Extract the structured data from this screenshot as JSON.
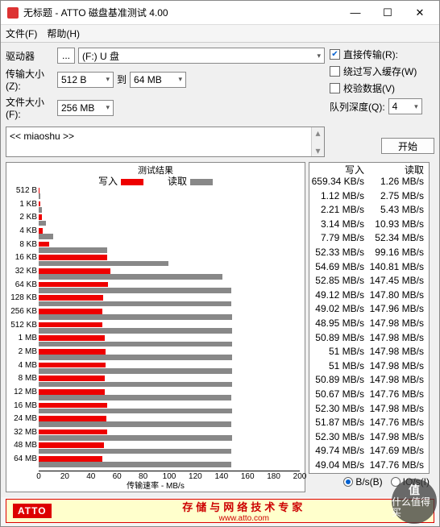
{
  "window": {
    "title": "无标题 - ATTO 磁盘基准测试 4.00",
    "min": "—",
    "max": "☐",
    "close": "✕"
  },
  "menu": {
    "file": "文件(F)",
    "help": "帮助(H)"
  },
  "labels": {
    "drive": "驱动器",
    "browse": "...",
    "drive_val": "(F:) U 盘",
    "xfer": "传输大小(Z):",
    "xfer_from": "512 B",
    "to": "到",
    "xfer_to": "64 MB",
    "file": "文件大小(F):",
    "file_val": "256 MB",
    "direct": "直接传输(R):",
    "bypass": "绕过写入缓存(W)",
    "verify": "校验数据(V)",
    "qd": "队列深度(Q):",
    "qd_val": "4",
    "desc": "<< miaoshu >>",
    "start": "开始",
    "result_title": "测试结果",
    "write": "写入",
    "read": "读取",
    "xlabel": "传输速率 - MB/s",
    "bs": "B/s(B)",
    "ios": "IO/s(I)"
  },
  "footer": {
    "logo": "ATTO",
    "l1": "存储与网络技术专家",
    "l2": "www.atto.com"
  },
  "watermark": {
    "v": "值",
    "t": "什么值得买"
  },
  "chart_data": {
    "type": "bar",
    "xlabel": "传输速率 - MB/s",
    "xlim": [
      0,
      200
    ],
    "xticks": [
      0,
      20,
      40,
      60,
      80,
      100,
      120,
      140,
      160,
      180,
      200
    ],
    "categories": [
      "512 B",
      "1 KB",
      "2 KB",
      "4 KB",
      "8 KB",
      "16 KB",
      "32 KB",
      "64 KB",
      "128 KB",
      "256 KB",
      "512 KB",
      "1 MB",
      "2 MB",
      "4 MB",
      "8 MB",
      "12 MB",
      "16 MB",
      "24 MB",
      "32 MB",
      "48 MB",
      "64 MB"
    ],
    "series": [
      {
        "name": "写入",
        "color": "#e00",
        "unit": "MB/s",
        "labels": [
          "659.34 KB/s",
          "1.12 MB/s",
          "2.21 MB/s",
          "3.14 MB/s",
          "7.79 MB/s",
          "52.33 MB/s",
          "54.69 MB/s",
          "52.85 MB/s",
          "49.12 MB/s",
          "49.02 MB/s",
          "48.95 MB/s",
          "50.89 MB/s",
          "51 MB/s",
          "51 MB/s",
          "50.89 MB/s",
          "50.67 MB/s",
          "52.30 MB/s",
          "51.87 MB/s",
          "52.30 MB/s",
          "49.74 MB/s",
          "49.04 MB/s"
        ],
        "values": [
          0.64,
          1.12,
          2.21,
          3.14,
          7.79,
          52.33,
          54.69,
          52.85,
          49.12,
          49.02,
          48.95,
          50.89,
          51,
          51,
          50.89,
          50.67,
          52.3,
          51.87,
          52.3,
          49.74,
          49.04
        ]
      },
      {
        "name": "读取",
        "color": "#888",
        "unit": "MB/s",
        "labels": [
          "1.26 MB/s",
          "2.75 MB/s",
          "5.43 MB/s",
          "10.93 MB/s",
          "52.34 MB/s",
          "99.16 MB/s",
          "140.81 MB/s",
          "147.45 MB/s",
          "147.80 MB/s",
          "147.96 MB/s",
          "147.98 MB/s",
          "147.98 MB/s",
          "147.98 MB/s",
          "147.98 MB/s",
          "147.98 MB/s",
          "147.76 MB/s",
          "147.98 MB/s",
          "147.76 MB/s",
          "147.98 MB/s",
          "147.69 MB/s",
          "147.76 MB/s"
        ],
        "values": [
          1.26,
          2.75,
          5.43,
          10.93,
          52.34,
          99.16,
          140.81,
          147.45,
          147.8,
          147.96,
          147.98,
          147.98,
          147.98,
          147.98,
          147.98,
          147.76,
          147.98,
          147.76,
          147.98,
          147.69,
          147.76
        ]
      }
    ]
  }
}
